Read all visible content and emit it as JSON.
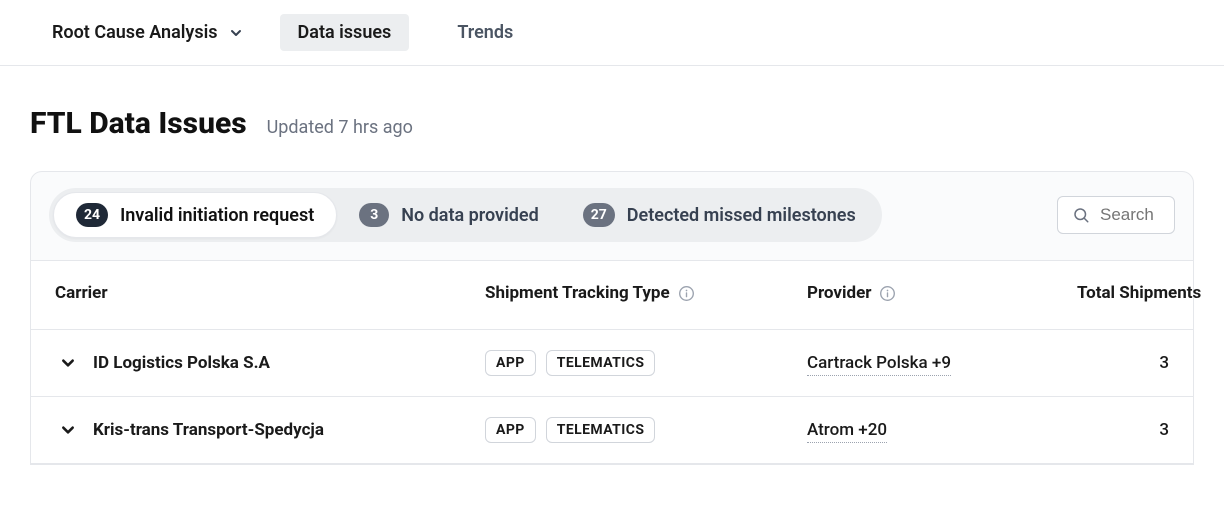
{
  "nav": {
    "dropdown_label": "Root Cause Analysis",
    "tabs": [
      {
        "label": "Data issues",
        "active": true
      },
      {
        "label": "Trends",
        "active": false
      }
    ]
  },
  "header": {
    "title": "FTL Data Issues",
    "updated": "Updated 7 hrs ago"
  },
  "filters": [
    {
      "count": "24",
      "label": "Invalid initiation request",
      "active": true
    },
    {
      "count": "3",
      "label": "No data provided",
      "active": false
    },
    {
      "count": "27",
      "label": "Detected missed milestones",
      "active": false
    }
  ],
  "search": {
    "placeholder": "Search"
  },
  "table": {
    "headers": {
      "carrier": "Carrier",
      "tracking": "Shipment Tracking Type",
      "provider": "Provider",
      "total": "Total Shipments"
    },
    "rows": [
      {
        "carrier": "ID Logistics Polska S.A",
        "tracking": [
          "APP",
          "TELEMATICS"
        ],
        "provider": "Cartrack Polska +9",
        "total": "3"
      },
      {
        "carrier": "Kris-trans Transport-Spedycja",
        "tracking": [
          "APP",
          "TELEMATICS"
        ],
        "provider": "Atrom +20",
        "total": "3"
      }
    ]
  }
}
